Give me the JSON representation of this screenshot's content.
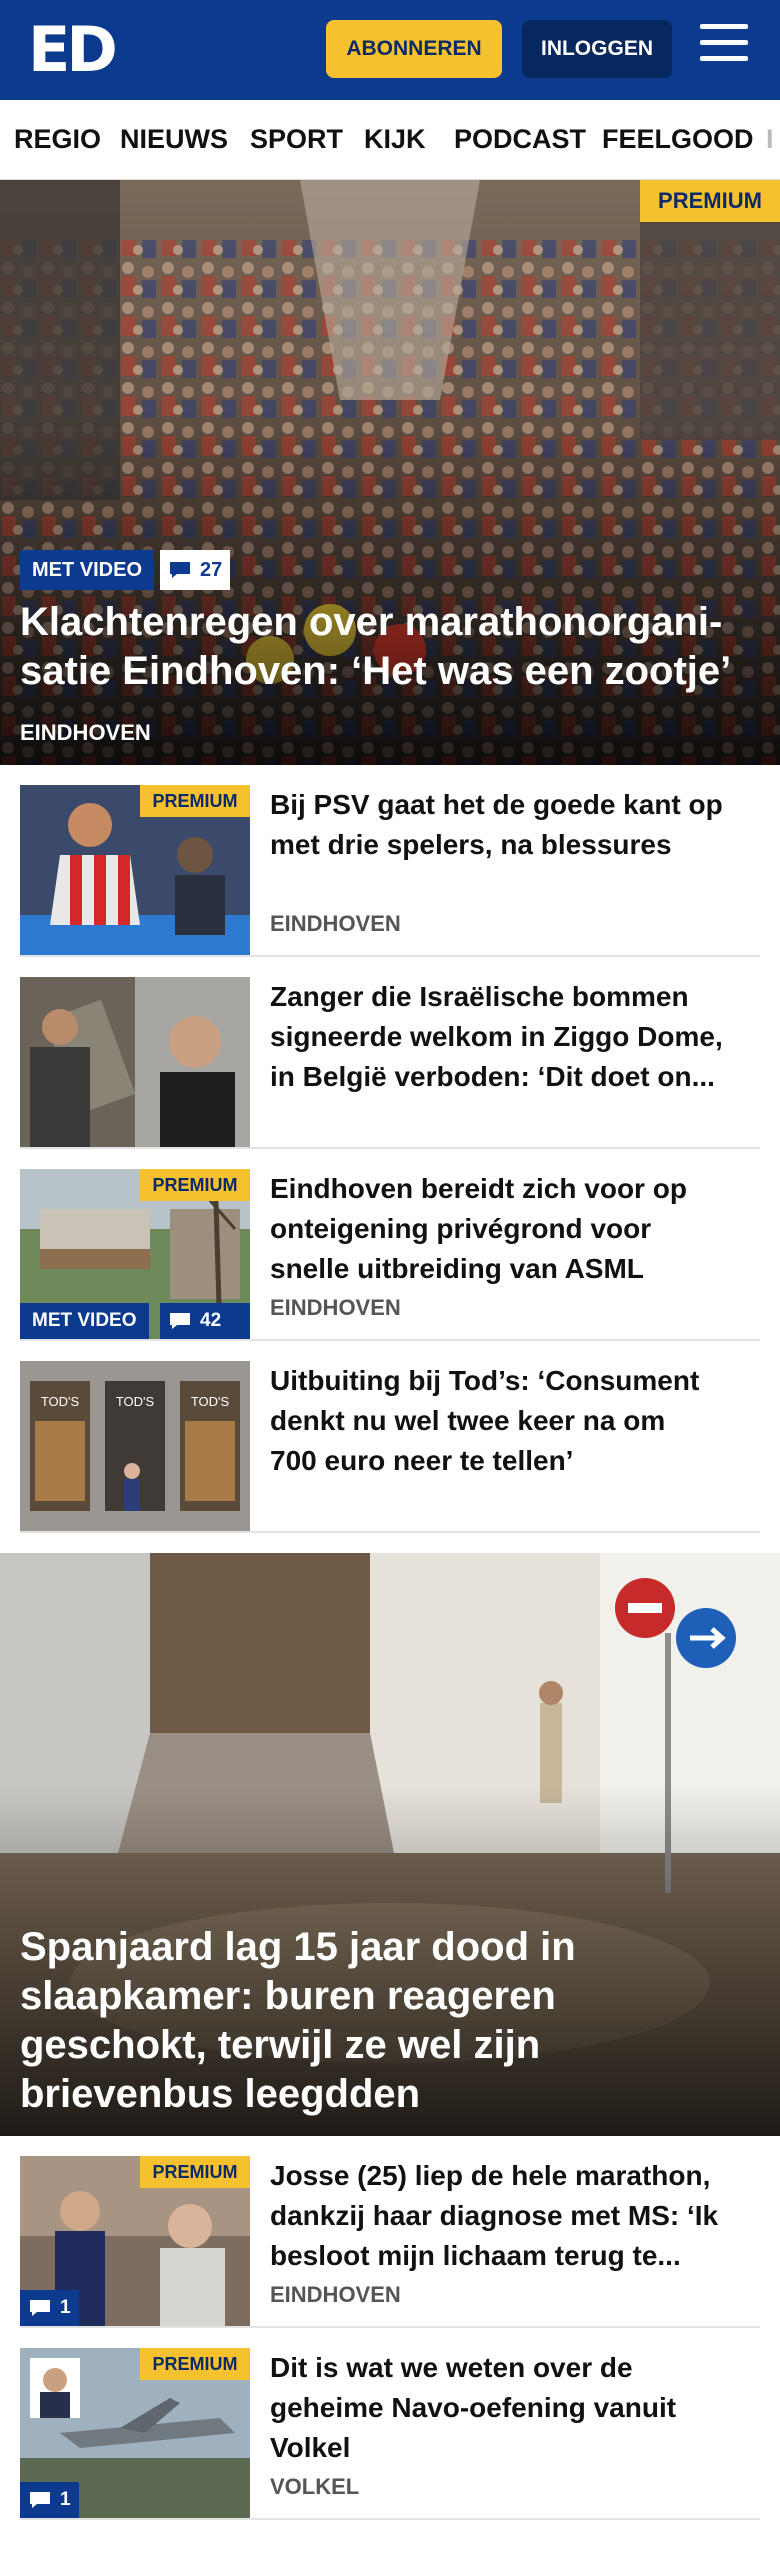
{
  "header": {
    "logo": "ED",
    "subscribe_label": "ABONNEREN",
    "login_label": "INLOGGEN",
    "menu_icon": "hamburger-menu-icon",
    "brand_color": "#0b3a8f",
    "accent_color": "#f6c12e"
  },
  "nav": {
    "items": [
      "REGIO",
      "NIEUWS",
      "SPORT",
      "KIJK",
      "PODCAST",
      "FEELGOOD",
      "I"
    ]
  },
  "hero1": {
    "premium": "PREMIUM",
    "video": "MET VIDEO",
    "comments": "27",
    "title_line1": "Klachtenregen over marathonorgani-",
    "title_line2": "satie Eindhoven: ‘Het was een zootje’",
    "label": "EINDHOVEN"
  },
  "articles": [
    {
      "premium": "PREMIUM",
      "title_lines": [
        "Bij PSV gaat het de goede kant op",
        "met drie spelers, na blessures"
      ],
      "label": "EINDHOVEN"
    },
    {
      "title_lines": [
        "Zanger die Israëlische bommen",
        "signeerde welkom in Ziggo Dome,",
        "in België verboden: ‘Dit doet on..."
      ]
    },
    {
      "premium": "PREMIUM",
      "video": "MET VIDEO",
      "comments": "42",
      "title_lines": [
        "Eindhoven bereidt zich voor op",
        "onteigening privégrond voor",
        "snelle uitbreiding van ASML"
      ],
      "label": "EINDHOVEN"
    },
    {
      "title_lines": [
        "Uitbuiting bij Tod’s: ‘Consument",
        "denkt nu wel twee keer na om",
        "700 euro neer te tellen’"
      ],
      "sign_text": "TOD'S"
    }
  ],
  "hero2": {
    "title_lines": [
      "Spanjaard lag 15 jaar dood in",
      "slaapkamer: buren reageren",
      "geschokt, terwijl ze wel zijn",
      "brievenbus leegdden"
    ]
  },
  "articles2": [
    {
      "premium": "PREMIUM",
      "comments": "1",
      "title_lines": [
        "Josse (25) liep de hele marathon,",
        "dankzij haar diagnose met MS: ‘Ik",
        "besloot mijn lichaam terug te..."
      ],
      "label": "EINDHOVEN"
    },
    {
      "premium": "PREMIUM",
      "comments": "1",
      "title_lines": [
        "Dit is wat we weten over de",
        "geheime Navo-oefening vanuit",
        "Volkel"
      ],
      "label": "VOLKEL"
    }
  ]
}
